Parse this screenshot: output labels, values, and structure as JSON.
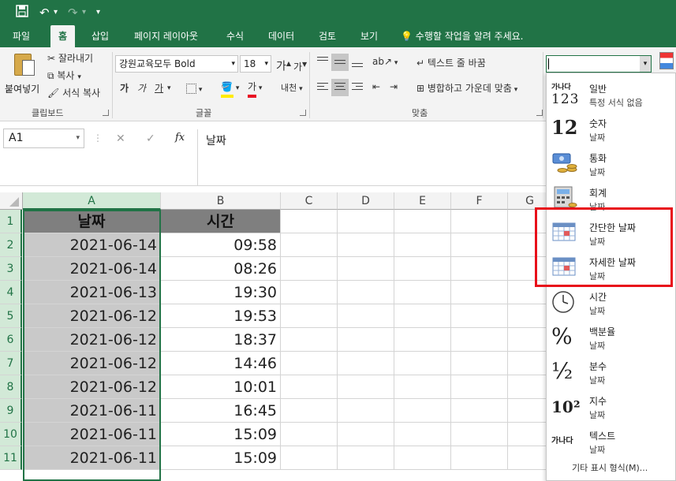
{
  "menu": {
    "items": [
      "파일",
      "홈",
      "삽입",
      "페이지 레이아웃",
      "수식",
      "데이터",
      "검토",
      "보기"
    ],
    "tell_me": "수행할 작업을 알려 주세요."
  },
  "ribbon": {
    "clipboard": {
      "paste": "붙여넣기",
      "cut": "잘라내기",
      "copy": "복사",
      "format_painter": "서식 복사",
      "group": "클립보드"
    },
    "font": {
      "name": "강원교육모두 Bold",
      "size": "18",
      "grow": "가",
      "shrink": "가",
      "bold": "가",
      "italic": "가",
      "underline": "가",
      "font_color": "가",
      "phonetic": "내천",
      "group": "글꼴"
    },
    "alignment": {
      "wrap": "텍스트 줄 바꿈",
      "merge": "병합하고 가운데 맞춤",
      "group": "맞춤"
    },
    "number_format_value": ""
  },
  "formula_bar": {
    "name_box": "A1",
    "cancel": "✕",
    "enter": "✓",
    "fx": "fx",
    "content": "날짜"
  },
  "sheet": {
    "columns": [
      "A",
      "B",
      "C",
      "D",
      "E",
      "F",
      "G"
    ],
    "rows": [
      "1",
      "2",
      "3",
      "4",
      "5",
      "6",
      "7",
      "8",
      "9",
      "10",
      "11"
    ],
    "header": [
      "날짜",
      "시간"
    ],
    "data": [
      [
        "2021-06-14",
        "09:58"
      ],
      [
        "2021-06-14",
        "08:26"
      ],
      [
        "2021-06-13",
        "19:30"
      ],
      [
        "2021-06-12",
        "19:53"
      ],
      [
        "2021-06-12",
        "18:37"
      ],
      [
        "2021-06-12",
        "14:46"
      ],
      [
        "2021-06-12",
        "10:01"
      ],
      [
        "2021-06-11",
        "16:45"
      ],
      [
        "2021-06-11",
        "15:09"
      ],
      [
        "2021-06-11",
        "15:09"
      ]
    ]
  },
  "number_format_menu": {
    "items": [
      {
        "name": "일반",
        "sample": "특정 서식 없음",
        "icon": "general-format-icon",
        "glyph_top": "가나다",
        "glyph_bottom": "123"
      },
      {
        "name": "숫자",
        "sample": "날짜",
        "icon": "number-format-icon",
        "glyph": "12"
      },
      {
        "name": "통화",
        "sample": "날짜",
        "icon": "currency-format-icon"
      },
      {
        "name": "회계",
        "sample": "날짜",
        "icon": "accounting-format-icon"
      },
      {
        "name": "간단한 날짜",
        "sample": "날짜",
        "icon": "short-date-icon"
      },
      {
        "name": "자세한 날짜",
        "sample": "날짜",
        "icon": "long-date-icon"
      },
      {
        "name": "시간",
        "sample": "날짜",
        "icon": "clock-icon"
      },
      {
        "name": "백분율",
        "sample": "날짜",
        "icon": "percent-icon",
        "glyph": "%"
      },
      {
        "name": "분수",
        "sample": "날짜",
        "icon": "fraction-icon",
        "glyph": "½"
      },
      {
        "name": "지수",
        "sample": "날짜",
        "icon": "scientific-icon",
        "glyph": "10²"
      },
      {
        "name": "텍스트",
        "sample": "날짜",
        "icon": "text-format-icon",
        "glyph": "가나다"
      }
    ],
    "more": "기타 표시 형식(M)..."
  },
  "colors": {
    "brand": "#217346",
    "highlight": "#e8101a",
    "date_fill": "#c9c9c9",
    "header_fill": "#7f7f7f"
  }
}
